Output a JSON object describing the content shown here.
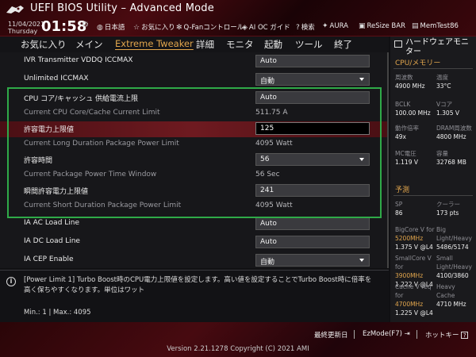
{
  "header": {
    "title": "UEFI BIOS Utility – Advanced Mode",
    "date": "11/04/2021",
    "day": "Thursday",
    "time": "01:58",
    "tools": [
      {
        "icon": "globe-icon",
        "label": "日本語"
      },
      {
        "icon": "star-icon",
        "label": "お気に入り"
      },
      {
        "icon": "fan-icon",
        "label": "Q-Fanコントロール"
      },
      {
        "icon": "ai-oc-icon",
        "label": "AI OC ガイド"
      },
      {
        "icon": "help-icon",
        "label": "検索"
      },
      {
        "icon": "aura-icon",
        "label": "AURA"
      },
      {
        "icon": "resize-bar-icon",
        "label": "ReSize BAR"
      },
      {
        "icon": "memtest-icon",
        "label": "MemTest86"
      }
    ]
  },
  "menu": {
    "tabs": [
      "お気に入り",
      "メイン",
      "Extreme Tweaker",
      "詳細",
      "モニタ",
      "起動",
      "ツール",
      "終了"
    ],
    "active_index": 2
  },
  "settings": [
    {
      "label": "IVR Transmitter VDDQ ICCMAX",
      "type": "box",
      "value": "Auto"
    },
    {
      "label": "Unlimited ICCMAX",
      "type": "select",
      "value": "自動"
    },
    {
      "label": "CPU コア/キャッシュ 供給電流上限",
      "type": "box",
      "value": "Auto"
    },
    {
      "label": "Current CPU Core/Cache Current Limit",
      "type": "text",
      "value": "511.75 A",
      "dim": true
    },
    {
      "label": "許容電力上限値",
      "type": "input",
      "value": "125",
      "selected": true
    },
    {
      "label": "Current Long Duration Package Power Limit",
      "type": "text",
      "value": "4095 Watt",
      "dim": true
    },
    {
      "label": "許容時間",
      "type": "select",
      "value": "56"
    },
    {
      "label": "Current Package Power Time Window",
      "type": "text",
      "value": "56 Sec",
      "dim": true
    },
    {
      "label": "瞬間許容電力上限値",
      "type": "box",
      "value": "241"
    },
    {
      "label": "Current Short Duration Package Power Limit",
      "type": "text",
      "value": "4095 Watt",
      "dim": true
    },
    {
      "label": "IA AC Load Line",
      "type": "box",
      "value": "Auto"
    },
    {
      "label": "IA DC Load Line",
      "type": "box",
      "value": "Auto"
    },
    {
      "label": "IA CEP Enable",
      "type": "select",
      "value": "自動"
    }
  ],
  "help": {
    "text": "[Power Limit 1] Turbo Boost時のCPU電力上限値を設定します。高い値を設定することでTurbo Boost時に倍率を高く保ちやすくなります。単位はワット",
    "min": "Min.: 1",
    "max": "Max.: 4095"
  },
  "hw": {
    "title": "ハードウェアモニター",
    "section_cpu": "CPU/メモリー",
    "cells": [
      {
        "k": "周波数",
        "v": "4900 MHz"
      },
      {
        "k": "温度",
        "v": "33°C"
      },
      {
        "k": "BCLK",
        "v": "100.00 MHz"
      },
      {
        "k": "Vコア",
        "v": "1.305 V"
      },
      {
        "k": "動作倍率",
        "v": "49x"
      },
      {
        "k": "DRAM周波数",
        "v": "4800 MHz"
      },
      {
        "k": "MC電圧",
        "v": "1.119 V"
      },
      {
        "k": "容量",
        "v": "32768 MB"
      }
    ],
    "section_predict": "予測",
    "sp_label": "SP",
    "sp_value": "86",
    "cooler_label": "クーラー",
    "cooler_value": "173 pts",
    "bigcore_label": "BigCore V for",
    "bigcore_freq": "5200MHz",
    "bigcore_value": "1.375 V @L4",
    "big_label": "Big Light/Heavy",
    "big_value": "5486/5174",
    "small_label": "SmallCore V for",
    "small_freq": "3900MHz",
    "small_value": "1.222 V @L4",
    "small2_label": "Small Light/Heavy",
    "small2_value": "4100/3860",
    "cache_label": "Cache V req for",
    "cache_freq": "4700MHz",
    "cache_value": "1.225 V @L4",
    "heavy_label": "Heavy Cache",
    "heavy_value": "4710 MHz"
  },
  "footer": {
    "last_modified": "最終更新日",
    "ezmode": "EzMode(F7)",
    "hotkey": "ホットキー",
    "version": "Version 2.21.1278 Copyright (C) 2021 AMI"
  }
}
